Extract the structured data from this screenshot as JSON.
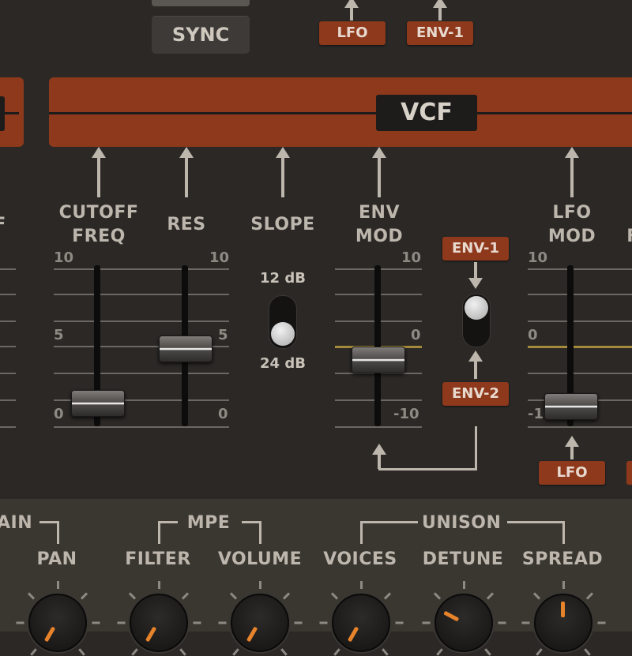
{
  "top": {
    "sync_label": "SYNC",
    "lfo_tag": "LFO",
    "env1_tag": "ENV-1"
  },
  "section": {
    "title": "VCF",
    "left_partial": "F"
  },
  "controls": {
    "left_partial_label": "F",
    "cutoff_label": "CUTOFF\nFREQ",
    "cutoff_line1": "CUTOFF",
    "cutoff_line2": "FREQ",
    "res_label": "RES",
    "slope_label": "SLOPE",
    "env_mod_line1": "ENV",
    "env_mod_line2": "MOD",
    "lfo_mod_line1": "LFO",
    "lfo_mod_line2": "MOD",
    "right_partial_label": "F"
  },
  "slider_scale": {
    "max": "10",
    "mid": "5",
    "min": "0"
  },
  "bipolar_scale": {
    "max": "10",
    "mid": "0",
    "min": "-10"
  },
  "sliders": {
    "cutoff": {
      "value": 0.08
    },
    "res": {
      "value": 0.48
    },
    "env_mod": {
      "value": 0.4
    },
    "lfo_mod": {
      "value": 0.06
    }
  },
  "slope": {
    "top_option": "12 dB",
    "bottom_option": "24 dB",
    "selected": "24 dB"
  },
  "env_switch": {
    "top_tag": "ENV-1",
    "bottom_tag": "ENV-2",
    "selected": "ENV-1"
  },
  "lfo_bottom_tag": "LFO",
  "bottom": {
    "group_left": "AIN",
    "pan": "PAN",
    "mpe": "MPE",
    "filter": "FILTER",
    "volume": "VOLUME",
    "unison": "UNISON",
    "voices": "VOICES",
    "detune": "DETUNE",
    "spread": "SPREAD"
  },
  "colors": {
    "accent_rust": "#8e391b",
    "background": "#2b2826",
    "bottom_panel": "#3a3731",
    "knob_indicator": "#e7832a",
    "zero_line": "#a48a3a"
  }
}
